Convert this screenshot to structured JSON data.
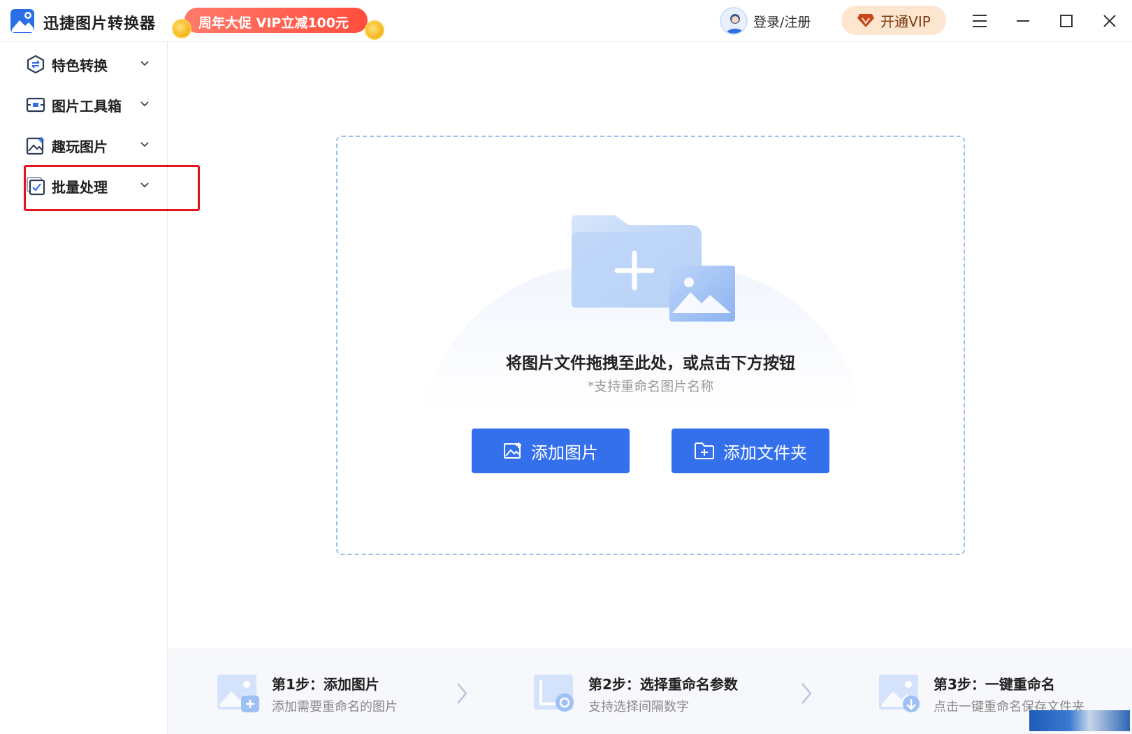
{
  "titlebar": {
    "app_name": "迅捷图片转换器",
    "promo_text": "周年大促 VIP立减100元",
    "login_label": "登录/注册",
    "vip_label": "开通VIP",
    "controls": [
      "menu-icon",
      "minimize-icon",
      "maximize-icon",
      "close-icon"
    ]
  },
  "sidebar": {
    "items": [
      {
        "label": "特色转换",
        "icon": "convert-icon"
      },
      {
        "label": "图片工具箱",
        "icon": "toolbox-icon"
      },
      {
        "label": "趣玩图片",
        "icon": "fun-image-icon"
      },
      {
        "label": "批量处理",
        "icon": "batch-icon",
        "highlighted": true
      }
    ]
  },
  "dropzone": {
    "title": "将图片文件拖拽至此处，或点击下方按钮",
    "subtitle": "*支持重命名图片名称",
    "add_image_label": "添加图片",
    "add_folder_label": "添加文件夹"
  },
  "steps": [
    {
      "title": "第1步：添加图片",
      "desc": "添加需要重命名的图片"
    },
    {
      "title": "第2步：选择重命名参数",
      "desc": "支持选择间隔数字"
    },
    {
      "title": "第3步：一键重命名",
      "desc": "点击一键重命名保存文件夹"
    }
  ],
  "colors": {
    "accent": "#3470ec",
    "highlight": "#e8111b",
    "promo": "#ff4d3d"
  }
}
